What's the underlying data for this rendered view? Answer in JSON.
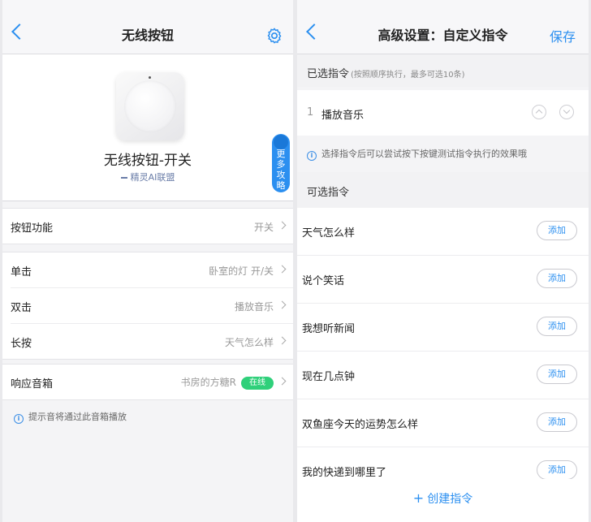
{
  "left": {
    "header": {
      "title": "无线按钮"
    },
    "device": {
      "name": "无线按钮-开关",
      "vendor": "精灵AI联盟",
      "more_tab": "更多攻略"
    },
    "function_row": {
      "label": "按钮功能",
      "value": "开关"
    },
    "actions": [
      {
        "label": "单击",
        "value": "卧室的灯 开/关"
      },
      {
        "label": "双击",
        "value": "播放音乐"
      },
      {
        "label": "长按",
        "value": "天气怎么样"
      }
    ],
    "speaker_row": {
      "label": "响应音箱",
      "value": "书房的方糖R",
      "status": "在线"
    },
    "note": "提示音将通过此音箱播放",
    "colors": {
      "accent": "#2b8ff0",
      "online": "#2fd07a"
    }
  },
  "right": {
    "header": {
      "title": "高级设置：自定义指令",
      "save": "保存"
    },
    "selected_section": {
      "title": "已选指令",
      "hint": "(按照顺序执行，最多可选10条)"
    },
    "selected": [
      {
        "index": "1",
        "label": "播放音乐"
      }
    ],
    "tip": "选择指令后可以尝试按下按键测试指令执行的效果哦",
    "available_section": {
      "title": "可选指令"
    },
    "add_label": "添加",
    "available": [
      {
        "label": "天气怎么样"
      },
      {
        "label": "说个笑话"
      },
      {
        "label": "我想听新闻"
      },
      {
        "label": "现在几点钟"
      },
      {
        "label": "双鱼座今天的运势怎么样"
      },
      {
        "label": "我的快递到哪里了"
      }
    ],
    "create": "创建指令"
  }
}
